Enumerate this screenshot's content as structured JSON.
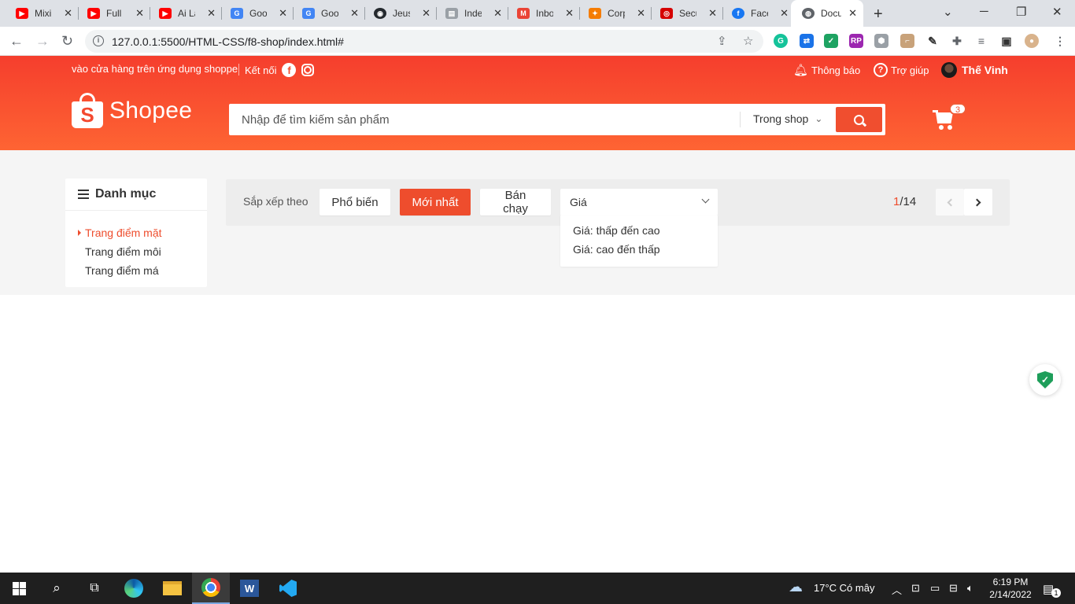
{
  "browser": {
    "tabs": [
      {
        "label": "MixiF",
        "fav_color": "#ff0000",
        "fav_glyph": "▶"
      },
      {
        "label": "Full L",
        "fav_color": "#ff0000",
        "fav_glyph": "▶"
      },
      {
        "label": "Ai Là",
        "fav_color": "#ff0000",
        "fav_glyph": "▶"
      },
      {
        "label": "Goog",
        "fav_color": "#4285f4",
        "fav_glyph": "G"
      },
      {
        "label": "Goog",
        "fav_color": "#4285f4",
        "fav_glyph": "G"
      },
      {
        "label": "Jeuss",
        "fav_color": "#24292e",
        "fav_glyph": "◉"
      },
      {
        "label": "Index",
        "fav_color": "#9aa0a6",
        "fav_glyph": "▤"
      },
      {
        "label": "Inbox",
        "fav_color": "#ea4335",
        "fav_glyph": "M"
      },
      {
        "label": "Corp",
        "fav_color": "#f57c00",
        "fav_glyph": "✦"
      },
      {
        "label": "Secu",
        "fav_color": "#d50000",
        "fav_glyph": "◎"
      },
      {
        "label": "Facel",
        "fav_color": "#1877f2",
        "fav_glyph": "f"
      },
      {
        "label": "Docu",
        "fav_color": "#5f6368",
        "fav_glyph": "◍"
      }
    ],
    "new_tab": "+",
    "url": "127.0.0.1:5500/HTML-CSS/f8-shop/index.html#"
  },
  "shop": {
    "topnav": {
      "app_link": "vào cửa hàng trên ứng dụng shoppe",
      "connect": "Kết nối",
      "notifications": "Thông báo",
      "help": "Trợ giúp",
      "user_name": "Thế Vinh"
    },
    "logo_text": "Shopee",
    "search": {
      "placeholder": "Nhập để tìm kiếm sản phẩm",
      "scope": "Trong shop"
    },
    "cart_count": "3",
    "category": {
      "heading": "Danh mục",
      "items": [
        "Trang điểm mặt",
        "Trang điểm môi",
        "Trang điểm má"
      ]
    },
    "filter": {
      "label": "Sắp xếp theo",
      "popular": "Phổ biến",
      "newest": "Mới nhất",
      "bestseller": "Bán chạy",
      "price": "Giá",
      "price_options": [
        "Giá: thấp đến cao",
        "Giá: cao đến thấp"
      ],
      "page_current": "1",
      "page_total": "/14"
    },
    "accent": "#ee4d2d"
  },
  "taskbar": {
    "weather": "17°C  Có mây",
    "time": "6:19 PM",
    "date": "2/14/2022",
    "notif_count": "1"
  }
}
